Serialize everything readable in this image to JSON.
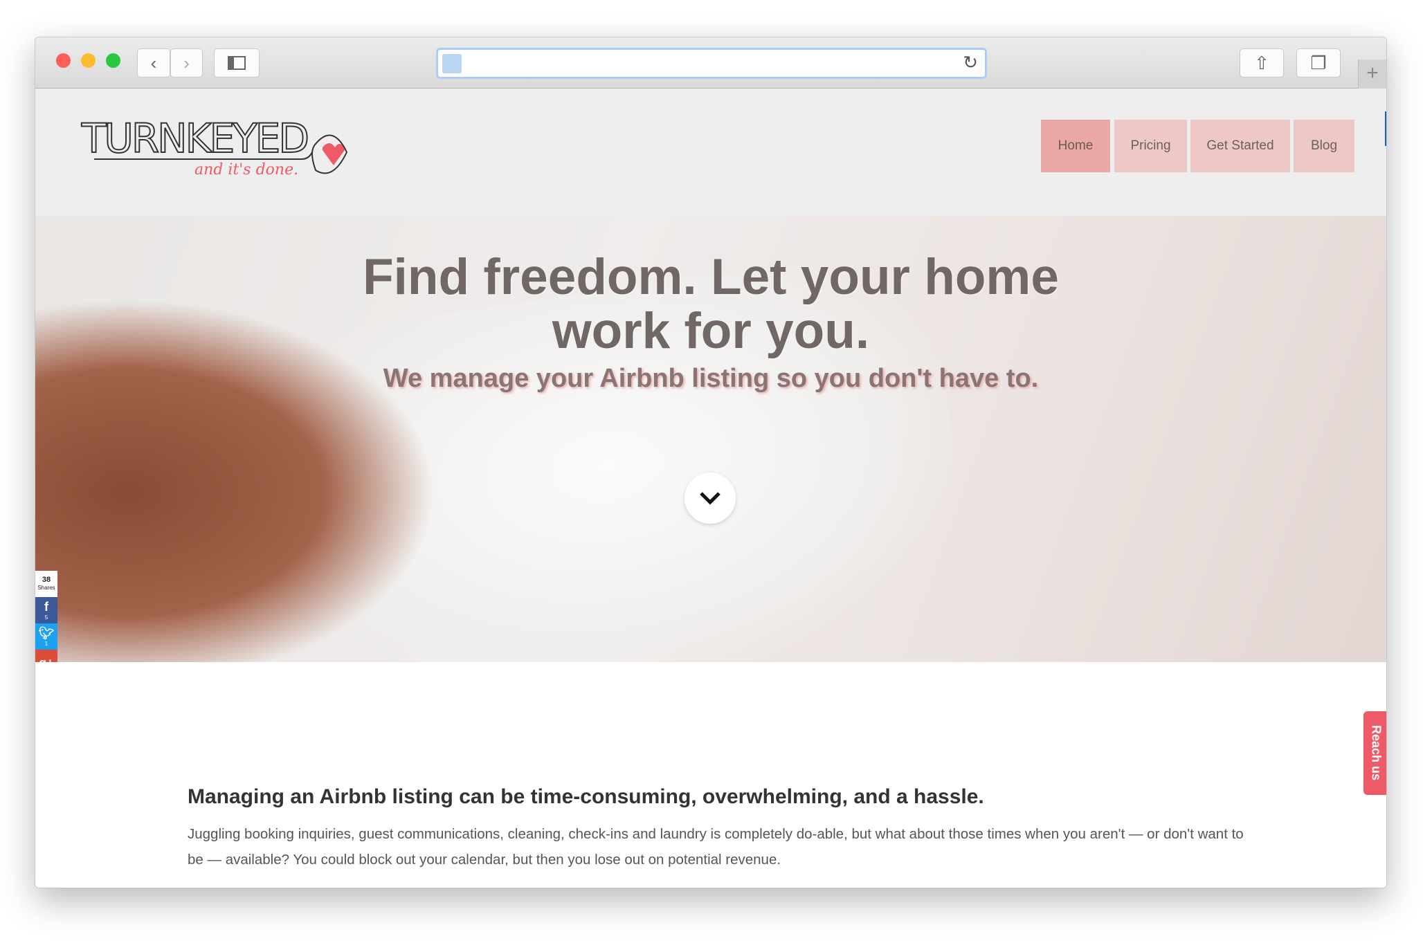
{
  "browser": {
    "url": "",
    "controls": [
      "back",
      "forward",
      "sidebar",
      "share",
      "tabs",
      "new-tab"
    ]
  },
  "logo": {
    "wordmark": "TURNKEYED",
    "tagline": "and it's done."
  },
  "nav": [
    {
      "label": "Home",
      "active": true
    },
    {
      "label": "Pricing"
    },
    {
      "label": "Get Started"
    },
    {
      "label": "Blog"
    }
  ],
  "hero": {
    "title": "Find freedom. Let your home work for you.",
    "subtitle": "We manage your Airbnb listing so you don't have to."
  },
  "share": {
    "count": "38",
    "count_label": "Shares",
    "facebook": "5",
    "twitter": "1",
    "colors": {
      "facebook": "#3b5998",
      "twitter": "#1da1f2",
      "googleplus": "#dd4b39",
      "buffer": "#222222",
      "email": "#b0b0b0",
      "sumo": "#1251c4"
    }
  },
  "content": {
    "heading": "Managing an Airbnb listing can be time-consuming, overwhelming, and a hassle.",
    "paragraph": "Juggling booking inquiries, guest communications, cleaning, check-ins and laundry is completely do-able, but what about those times when you aren't — or don't want to be — available? You could block out your calendar, but then you lose out on potential revenue."
  },
  "reach_us": "Reach us",
  "colors": {
    "accent": "#ee5b67",
    "nav_active": "#e9a8a4",
    "nav": "#edc8c6"
  }
}
